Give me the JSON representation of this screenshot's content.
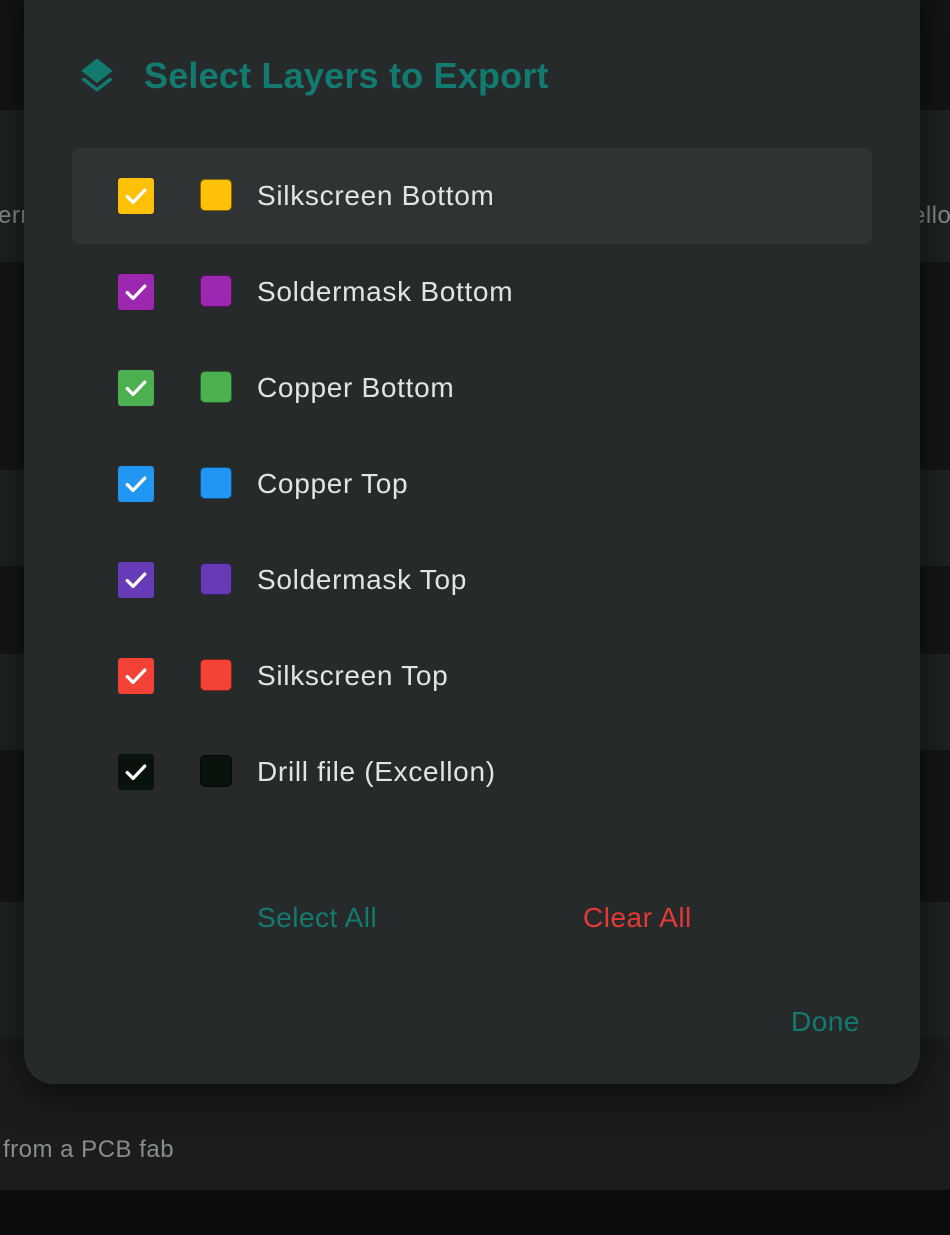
{
  "background": {
    "left_fragment": "ern",
    "right_fragment": "ello",
    "footer_caption": "from a PCB fab"
  },
  "dialog": {
    "title": "Select Layers to Export",
    "title_icon": "layers-icon",
    "accent_color": "#137a6f",
    "layers": [
      {
        "label": "Silkscreen Bottom",
        "color": "#ffc107",
        "checked": true
      },
      {
        "label": "Soldermask Bottom",
        "color": "#9c27b0",
        "checked": true
      },
      {
        "label": "Copper Bottom",
        "color": "#4caf50",
        "checked": true
      },
      {
        "label": "Copper Top",
        "color": "#2196f3",
        "checked": true
      },
      {
        "label": "Soldermask Top",
        "color": "#673ab7",
        "checked": true
      },
      {
        "label": "Silkscreen Top",
        "color": "#f44336",
        "checked": true
      },
      {
        "label": "Drill file (Excellon)",
        "color": "#0a120c",
        "checked": true
      }
    ],
    "partial_next_color": "#ffa000",
    "select_all_label": "Select All",
    "select_all_color": "#137a6f",
    "clear_all_label": "Clear All",
    "clear_all_color": "#e53935",
    "done_label": "Done"
  }
}
